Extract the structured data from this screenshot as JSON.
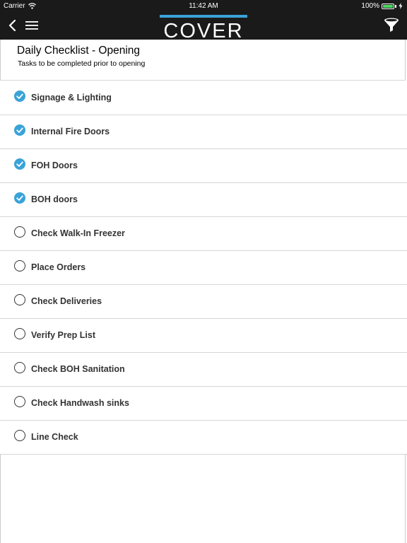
{
  "status_bar": {
    "carrier": "Carrier",
    "time": "11:42 AM",
    "battery_percent": "100%",
    "battery_level": 1.0
  },
  "nav": {
    "logo_text": "COVER",
    "logo_accent_color": "#3aa3d8",
    "icons": [
      "back-chevron-icon",
      "menu-icon",
      "filter-funnel-icon"
    ]
  },
  "header": {
    "title": "Daily Checklist - Opening",
    "subtitle": "Tasks to be completed prior to opening"
  },
  "checklist": [
    {
      "label": "Signage & Lighting",
      "checked": true
    },
    {
      "label": "Internal Fire Doors",
      "checked": true
    },
    {
      "label": "FOH Doors",
      "checked": true
    },
    {
      "label": "BOH doors",
      "checked": true
    },
    {
      "label": "Check Walk-In Freezer",
      "checked": false
    },
    {
      "label": "Place Orders",
      "checked": false
    },
    {
      "label": "Check Deliveries",
      "checked": false
    },
    {
      "label": "Verify Prep List",
      "checked": false
    },
    {
      "label": "Check BOH Sanitation",
      "checked": false
    },
    {
      "label": "Check Handwash sinks",
      "checked": false
    },
    {
      "label": "Line Check",
      "checked": false
    }
  ],
  "colors": {
    "topbar": "#1a1a1a",
    "check_accent": "#3aa3d8"
  }
}
